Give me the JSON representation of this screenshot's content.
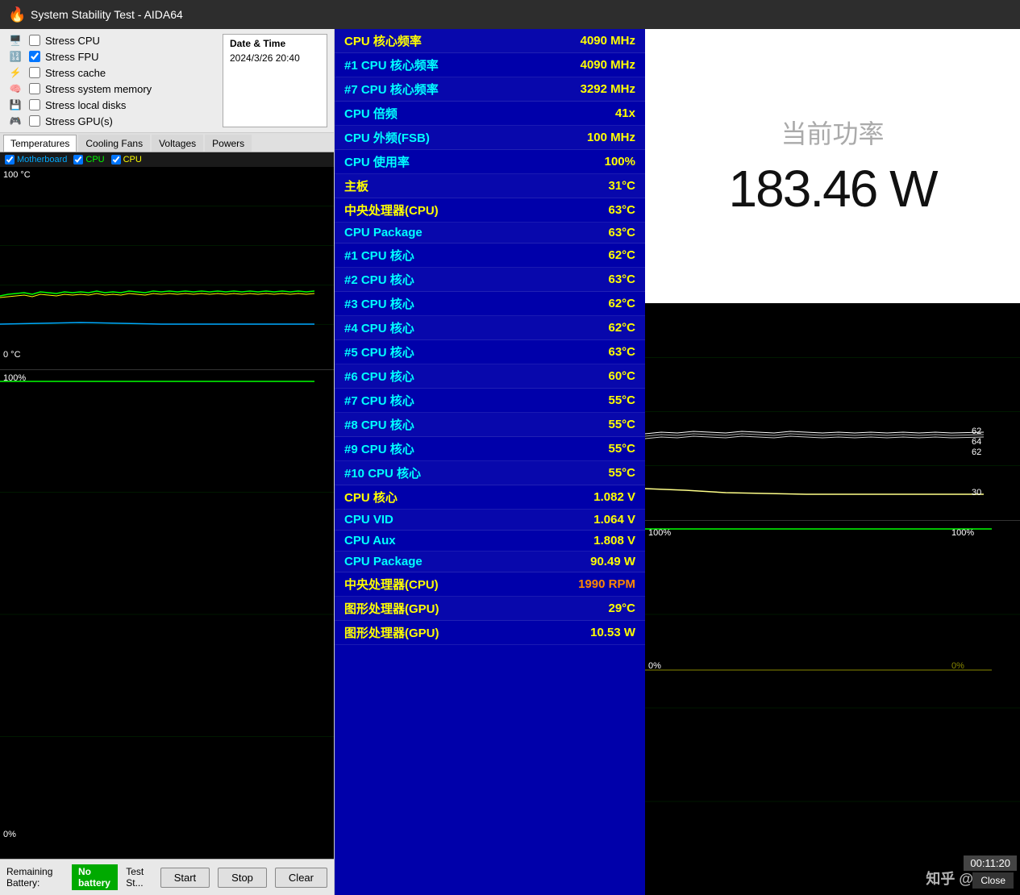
{
  "titleBar": {
    "icon": "🔥",
    "text": "System Stability Test - AIDA64"
  },
  "leftPanel": {
    "checkboxes": [
      {
        "id": "stress-cpu",
        "label": "Stress CPU",
        "checked": false,
        "icon": "🖥️"
      },
      {
        "id": "stress-fpu",
        "label": "Stress FPU",
        "checked": true,
        "icon": "🔢"
      },
      {
        "id": "stress-cache",
        "label": "Stress cache",
        "checked": false,
        "icon": "⚡"
      },
      {
        "id": "stress-memory",
        "label": "Stress system memory",
        "checked": false,
        "icon": "🧠"
      },
      {
        "id": "stress-disks",
        "label": "Stress local disks",
        "checked": false,
        "icon": "💾"
      },
      {
        "id": "stress-gpu",
        "label": "Stress GPU(s)",
        "checked": false,
        "icon": "🎮"
      }
    ],
    "datetime": {
      "label": "Date & Time",
      "value": "2024/3/26 20:40"
    },
    "tabs": [
      "Temperatures",
      "Cooling Fans",
      "Voltages",
      "Powers"
    ],
    "activeTab": "Temperatures",
    "legend": {
      "motherboard": "Motherboard",
      "cpu1": "CPU",
      "cpu2": "CPU"
    },
    "yAxisTop": "100 °C",
    "yAxisBottom": "0 °C",
    "yAxis2Top": "100%",
    "yAxis2Bottom": "0%",
    "battery": {
      "label": "Remaining Battery:",
      "value": "No battery"
    },
    "testStatus": "Test St...",
    "buttons": {
      "start": "Start",
      "stop": "Stop",
      "clear": "Clear"
    }
  },
  "centerPanel": {
    "rows": [
      {
        "label": "CPU 核心频率",
        "value": "4090 MHz",
        "labelColor": "yellow",
        "valueColor": "yellow"
      },
      {
        "label": "#1 CPU 核心频率",
        "value": "4090 MHz",
        "labelColor": "cyan",
        "valueColor": "yellow"
      },
      {
        "label": "#7 CPU 核心频率",
        "value": "3292 MHz",
        "labelColor": "cyan",
        "valueColor": "yellow"
      },
      {
        "label": "CPU 倍频",
        "value": "41x",
        "labelColor": "cyan",
        "valueColor": "yellow"
      },
      {
        "label": "CPU 外频(FSB)",
        "value": "100 MHz",
        "labelColor": "cyan",
        "valueColor": "yellow"
      },
      {
        "label": "CPU 使用率",
        "value": "100%",
        "labelColor": "cyan",
        "valueColor": "yellow"
      },
      {
        "label": "主板",
        "value": "31°C",
        "labelColor": "yellow",
        "valueColor": "yellow"
      },
      {
        "label": "中央处理器(CPU)",
        "value": "63°C",
        "labelColor": "yellow",
        "valueColor": "yellow"
      },
      {
        "label": "CPU Package",
        "value": "63°C",
        "labelColor": "cyan",
        "valueColor": "yellow"
      },
      {
        "label": "#1 CPU 核心",
        "value": "62°C",
        "labelColor": "cyan",
        "valueColor": "yellow"
      },
      {
        "label": "#2 CPU 核心",
        "value": "63°C",
        "labelColor": "cyan",
        "valueColor": "yellow"
      },
      {
        "label": "#3 CPU 核心",
        "value": "62°C",
        "labelColor": "cyan",
        "valueColor": "yellow"
      },
      {
        "label": "#4 CPU 核心",
        "value": "62°C",
        "labelColor": "cyan",
        "valueColor": "yellow"
      },
      {
        "label": "#5 CPU 核心",
        "value": "63°C",
        "labelColor": "cyan",
        "valueColor": "yellow"
      },
      {
        "label": "#6 CPU 核心",
        "value": "60°C",
        "labelColor": "cyan",
        "valueColor": "yellow"
      },
      {
        "label": "#7 CPU 核心",
        "value": "55°C",
        "labelColor": "cyan",
        "valueColor": "yellow"
      },
      {
        "label": "#8 CPU 核心",
        "value": "55°C",
        "labelColor": "cyan",
        "valueColor": "yellow"
      },
      {
        "label": "#9 CPU 核心",
        "value": "55°C",
        "labelColor": "cyan",
        "valueColor": "yellow"
      },
      {
        "label": "#10 CPU 核心",
        "value": "55°C",
        "labelColor": "cyan",
        "valueColor": "yellow"
      },
      {
        "label": "CPU 核心",
        "value": "1.082 V",
        "labelColor": "yellow",
        "valueColor": "yellow"
      },
      {
        "label": "CPU VID",
        "value": "1.064 V",
        "labelColor": "cyan",
        "valueColor": "yellow"
      },
      {
        "label": "CPU Aux",
        "value": "1.808 V",
        "labelColor": "cyan",
        "valueColor": "yellow"
      },
      {
        "label": "CPU Package",
        "value": "90.49 W",
        "labelColor": "cyan",
        "valueColor": "yellow"
      },
      {
        "label": "中央处理器(CPU)",
        "value": "1990 RPM",
        "labelColor": "yellow",
        "valueColor": "orange"
      },
      {
        "label": "图形处理器(GPU)",
        "value": "29°C",
        "labelColor": "yellow",
        "valueColor": "yellow"
      },
      {
        "label": "图形处理器(GPU)",
        "value": "10.53 W",
        "labelColor": "yellow",
        "valueColor": "yellow"
      }
    ]
  },
  "rightPanel": {
    "powerLabel": "当前功率",
    "powerValue": "183.46 W",
    "timer": "00:11:20",
    "watermark": "知乎 @pj247",
    "closeBtn": "Close",
    "rightChartTopLabels": {
      "val62a": "62",
      "val64": "64",
      "val62b": "62",
      "val30": "30"
    },
    "rightChartBottomLabels": {
      "top": "100%",
      "bottom": "0%"
    }
  }
}
